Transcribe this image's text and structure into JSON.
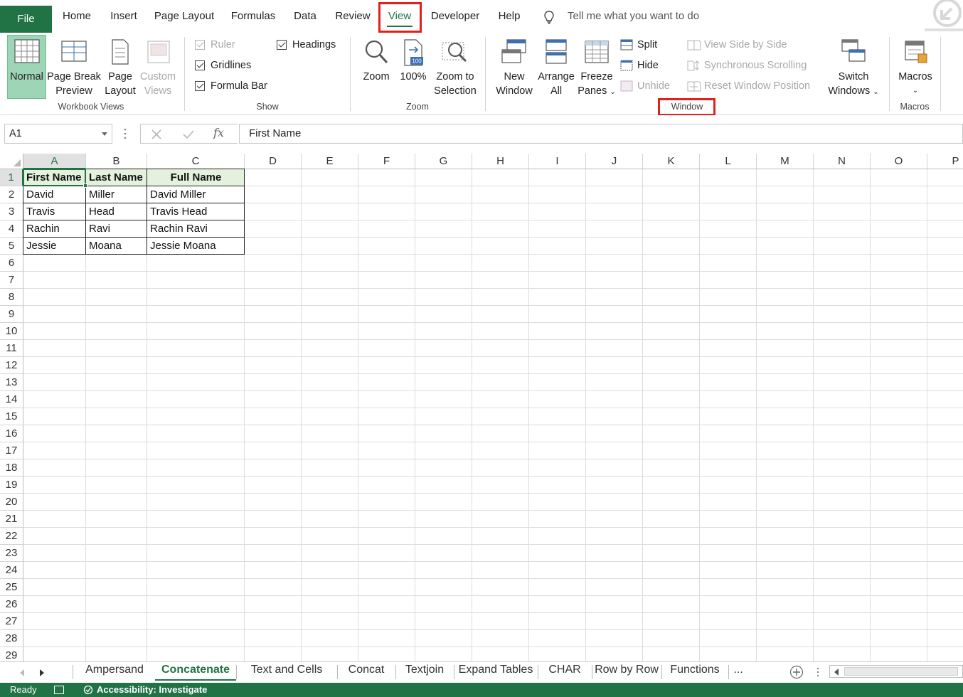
{
  "menu": {
    "tabs": [
      "File",
      "Home",
      "Insert",
      "Page Layout",
      "Formulas",
      "Data",
      "Review",
      "View",
      "Developer",
      "Help"
    ],
    "active_tab": "View",
    "tell_me": "Tell me what you want to do"
  },
  "ribbon": {
    "workbook_views": {
      "label": "Workbook Views",
      "normal": "Normal",
      "page_break": [
        "Page Break",
        "Preview"
      ],
      "page_layout": [
        "Page",
        "Layout"
      ],
      "custom_views": [
        "Custom",
        "Views"
      ]
    },
    "show": {
      "label": "Show",
      "ruler": "Ruler",
      "gridlines": "Gridlines",
      "formula_bar": "Formula Bar",
      "headings": "Headings"
    },
    "zoom": {
      "label": "Zoom",
      "zoom": "Zoom",
      "hundred": "100%",
      "zoom_to_selection": [
        "Zoom to",
        "Selection"
      ],
      "badge": "100"
    },
    "window": {
      "label": "Window",
      "new_window": [
        "New",
        "Window"
      ],
      "arrange_all": [
        "Arrange",
        "All"
      ],
      "freeze_panes": [
        "Freeze",
        "Panes"
      ],
      "split": "Split",
      "hide": "Hide",
      "unhide": "Unhide",
      "view_side_by_side": "View Side by Side",
      "sync_scrolling": "Synchronous Scrolling",
      "reset_window": "Reset Window Position",
      "switch_windows": [
        "Switch",
        "Windows"
      ]
    },
    "macros": {
      "label": "Macros",
      "macros": "Macros"
    }
  },
  "formula_bar": {
    "name_box": "A1",
    "fx": "fx",
    "value": "First Name"
  },
  "grid": {
    "columns": [
      "A",
      "B",
      "C",
      "D",
      "E",
      "F",
      "G",
      "H",
      "I",
      "J",
      "K",
      "L",
      "M",
      "N",
      "O",
      "P"
    ],
    "rows": [
      "1",
      "2",
      "3",
      "4",
      "5",
      "6",
      "7",
      "8",
      "9",
      "10",
      "11",
      "12",
      "13",
      "14",
      "15",
      "16",
      "17",
      "18",
      "19",
      "20",
      "21",
      "22",
      "23",
      "24",
      "25",
      "26",
      "27",
      "28",
      "29"
    ],
    "headers": [
      "First Name",
      "Last Name",
      "Full Name"
    ],
    "data": [
      [
        "David",
        "Miller",
        "David Miller"
      ],
      [
        "Travis",
        "Head",
        "Travis Head"
      ],
      [
        "Rachin",
        "Ravi",
        "Rachin Ravi"
      ],
      [
        "Jessie",
        "Moana",
        "Jessie Moana"
      ]
    ],
    "active_cell": "A1"
  },
  "sheets": {
    "tabs": [
      "Ampersand",
      "Concatenate",
      "Text and Cells",
      "Concat",
      "Textjoin",
      "Expand Tables",
      "CHAR",
      "Row by Row",
      "Functions"
    ],
    "active": "Concatenate",
    "more": "..."
  },
  "status": {
    "ready": "Ready",
    "accessibility": "Accessibility: Investigate"
  },
  "colors": {
    "accent": "#217346",
    "highlight": "#e0201b",
    "header_fill": "#e3f1dd"
  }
}
